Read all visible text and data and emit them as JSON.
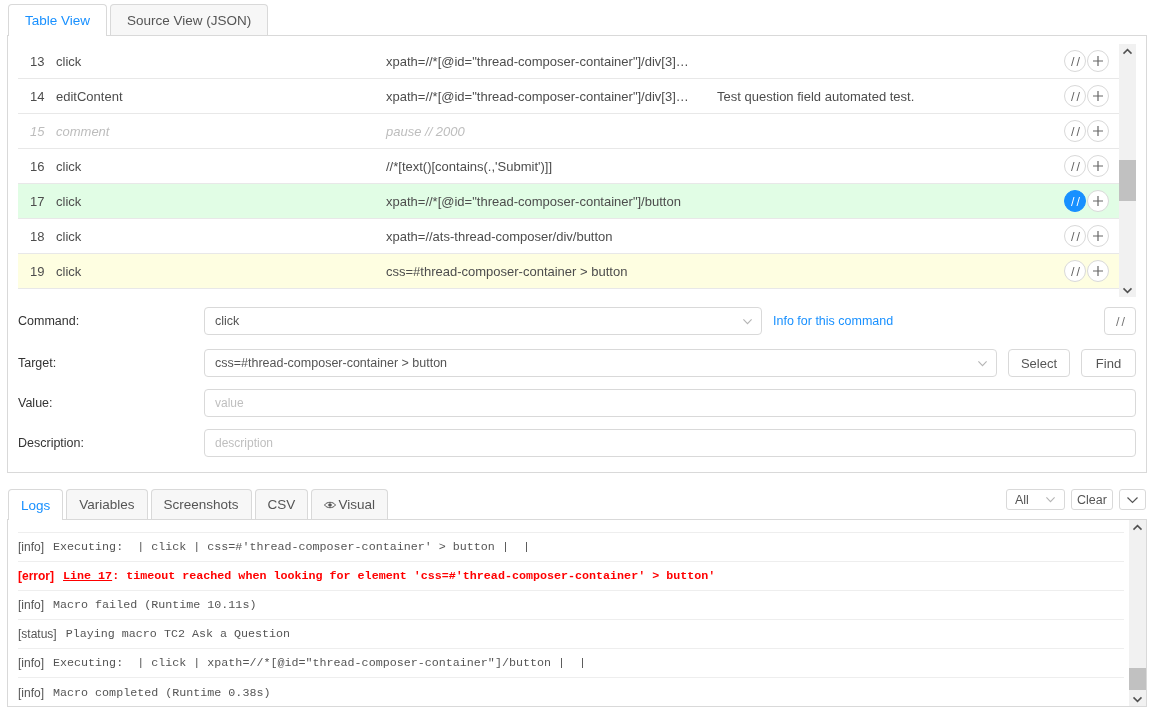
{
  "editor_tabs": [
    {
      "label": "Table View",
      "selected": true
    },
    {
      "label": "Source View (JSON)",
      "selected": false
    }
  ],
  "commands": [
    {
      "index": "13",
      "kind": "command",
      "command": "click",
      "target": "xpath=//*[@id=\"thread-composer-container\"]/div[3]…",
      "passed": false,
      "selected": false,
      "comment_button_highlighted": false
    },
    {
      "index": "14",
      "kind": "command",
      "command": "editContent",
      "target": "xpath=//*[@id=\"thread-composer-container\"]/div[3]…",
      "value": "Test question field automated test.",
      "passed": false,
      "selected": false,
      "comment_button_highlighted": false
    },
    {
      "index": "15",
      "kind": "comment",
      "command": "comment",
      "target": "pause // 2000",
      "passed": false,
      "selected": false,
      "comment_button_highlighted": false
    },
    {
      "index": "16",
      "kind": "command",
      "command": "click",
      "target": "//*[text()[contains(.,'Submit')]]",
      "passed": false,
      "selected": false,
      "comment_button_highlighted": false
    },
    {
      "index": "17",
      "kind": "command",
      "command": "click",
      "target": "xpath=//*[@id=\"thread-composer-container\"]/button",
      "passed": true,
      "selected": false,
      "comment_button_highlighted": true
    },
    {
      "index": "18",
      "kind": "command",
      "command": "click",
      "target": "xpath=//ats-thread-composer/div/button",
      "passed": false,
      "selected": false,
      "comment_button_highlighted": false
    },
    {
      "index": "19",
      "kind": "command",
      "command": "click",
      "target": "css=#thread-composer-container > button",
      "passed": false,
      "selected": true,
      "comment_button_highlighted": false
    }
  ],
  "command_form": {
    "command": {
      "label": "Command:",
      "value": "click"
    },
    "info_link": "Info for this command",
    "target": {
      "label": "Target:",
      "value": "css=#thread-composer-container > button"
    },
    "select_button": "Select",
    "find_button": "Find",
    "value": {
      "label": "Value:",
      "placeholder": "value"
    },
    "description": {
      "label": "Description:",
      "placeholder": "description"
    }
  },
  "log_tabs": [
    {
      "label": "Logs",
      "kind": "text",
      "selected": true
    },
    {
      "label": "Variables",
      "kind": "text",
      "selected": false
    },
    {
      "label": "Screenshots",
      "kind": "text",
      "selected": false
    },
    {
      "label": "CSV",
      "kind": "text",
      "selected": false
    },
    {
      "label": "Visual",
      "kind": "with_icon",
      "selected": false
    }
  ],
  "log_filter": {
    "value": "All"
  },
  "clear_button": "Clear",
  "logs": [
    {
      "kind": "info",
      "level": "[info]",
      "message": "Executing:  | click | css=#'thread-composer-container' > button |  |"
    },
    {
      "kind": "error",
      "level": "[error]",
      "link": "Line 17",
      "message": ": timeout reached when looking for element 'css=#'thread-composer-container' > button'"
    },
    {
      "kind": "info",
      "level": "[info]",
      "message": "Macro failed (Runtime 10.11s)"
    },
    {
      "kind": "status",
      "level": "[status]",
      "message": "Playing macro TC2 Ask a Question"
    },
    {
      "kind": "info",
      "level": "[info]",
      "message": "Executing:  | click | xpath=//*[@id=\"thread-composer-container\"]/button |  |"
    },
    {
      "kind": "info",
      "level": "[info]",
      "message": "Macro completed (Runtime 0.38s)"
    }
  ]
}
